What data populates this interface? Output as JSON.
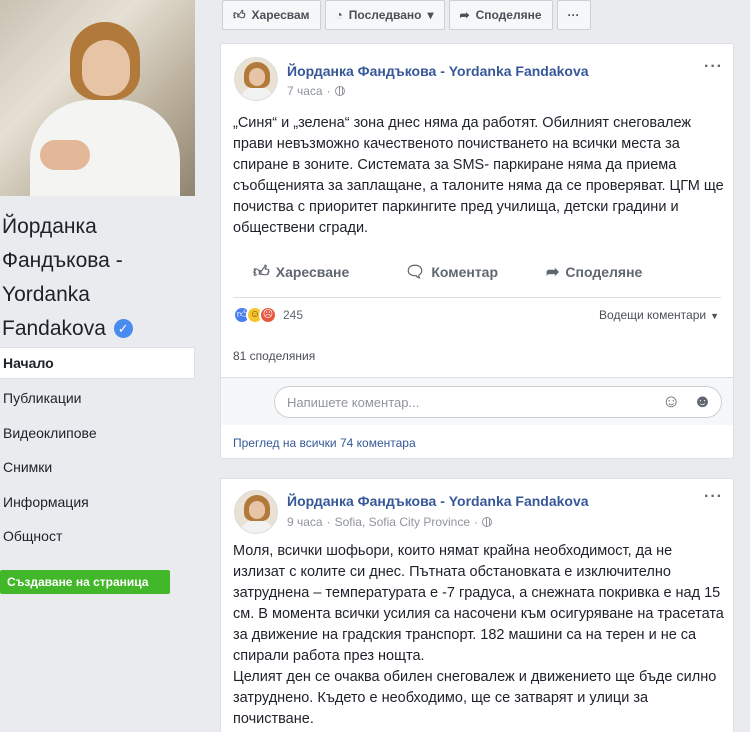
{
  "page": {
    "name_lines": [
      "Йорданка",
      "Фандъкова -",
      "Yordanka",
      "Fandakova"
    ],
    "verified_icon": "verified-check-icon",
    "nav": [
      {
        "label": "Начало",
        "active": true
      },
      {
        "label": "Публикации",
        "active": false
      },
      {
        "label": "Видеоклипове",
        "active": false
      },
      {
        "label": "Снимки",
        "active": false
      },
      {
        "label": "Информация",
        "active": false
      },
      {
        "label": "Общност",
        "active": false
      }
    ],
    "create_page_label": "Създаване на страница"
  },
  "topbar": {
    "like_label": "Харесвам",
    "follow_label": "Последвано",
    "share_label": "Споделяне",
    "more_label": "···"
  },
  "post1": {
    "author": "Йорданка Фандъкова - Yordanka Fandakova",
    "time": "7 часа",
    "text": "„Синя“ и „зелена“ зона днес няма да работят. Обилният снеговалеж прави невъзможно качественото почистването на всички места за спиране в зоните. Системата за SMS- паркиране няма да приема съобщенията за заплащане, а талоните няма да се проверяват. ЦГМ ще почиства с приоритет паркингите пред училища, детски градини и обществени сгради.",
    "actions": {
      "like": "Харесване",
      "comment": "Коментар",
      "share": "Споделяне"
    },
    "reaction_count": "245",
    "sort_label": "Водещи коментари",
    "shares": "81 споделяния",
    "comment_placeholder": "Напишете коментар...",
    "view_all": "Преглед на всички 74 коментара"
  },
  "post2": {
    "author": "Йорданка Фандъкова - Yordanka Fandakova",
    "time": "9 часа",
    "location": "Sofia, Sofia City Province",
    "text": "Моля, всички шофьори, които нямат крайна необходимост, да не излизат с колите си днес. Пътната обстановката е изключително затруднена – температурата е -7 градуса, а снежната покривка е над 15 см. В момента всички усилия са насочени към осигуряване на трасетата за движение на градския транспорт. 182 машини са на терен и не са спирали работа през нощта.\nЦелият ден се очаква обилен снеговалеж и движението ще бъде силно затруднено. Където е необходимо, ще се затварят и улици за почистване."
  },
  "colors": {
    "link_blue": "#365899",
    "green_button": "#42b72a",
    "background": "#e9ebee"
  }
}
